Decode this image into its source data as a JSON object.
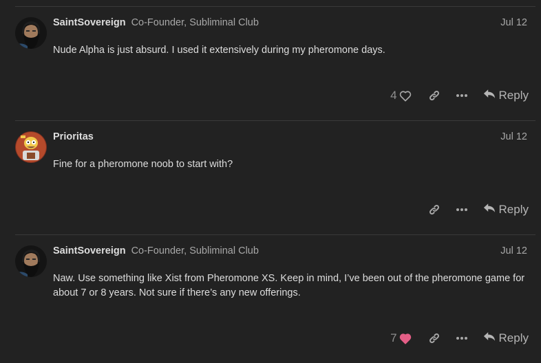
{
  "posts": [
    {
      "username": "SaintSovereign",
      "user_title": "Co-Founder, Subliminal Club",
      "date": "Jul 12",
      "avatar_icon": "bearded-man-avatar-icon",
      "body": "Nude Alpha is just absurd. I used it extensively during my pheromone days.",
      "likes": "4",
      "liked": false,
      "reply_label": "Reply"
    },
    {
      "username": "Prioritas",
      "user_title": "",
      "date": "Jul 12",
      "avatar_icon": "cartoon-character-avatar-icon",
      "body": "Fine for a pheromone noob to start with?",
      "likes": "",
      "liked": false,
      "reply_label": "Reply"
    },
    {
      "username": "SaintSovereign",
      "user_title": "Co-Founder, Subliminal Club",
      "date": "Jul 12",
      "avatar_icon": "bearded-man-avatar-icon",
      "body": "Naw. Use something like Xist from Pheromone XS. Keep in mind, I’ve been out of the pheromone game for about 7 or 8 years. Not sure if there’s any new offerings.",
      "likes": "7",
      "liked": true,
      "reply_label": "Reply"
    }
  ],
  "colors": {
    "background": "#222222",
    "text": "#dddddd",
    "muted": "#a8a8a8",
    "heart_liked": "#e45e86"
  }
}
